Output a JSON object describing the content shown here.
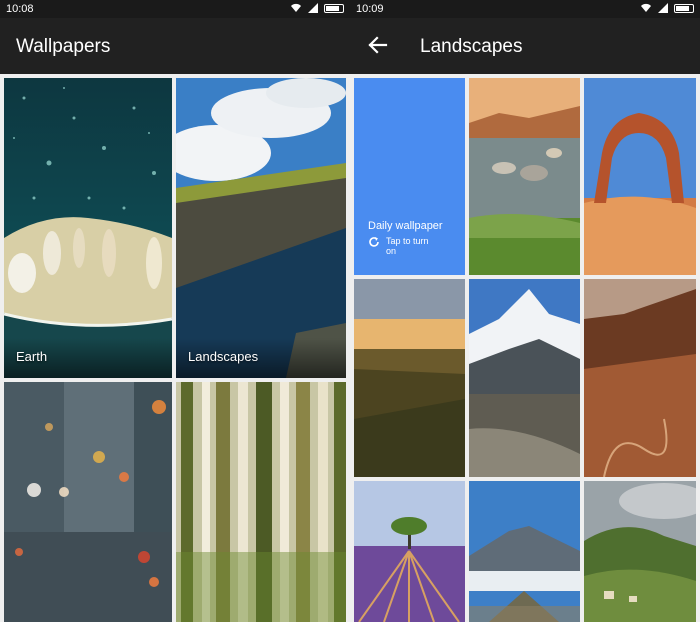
{
  "left_screen": {
    "status": {
      "time": "10:08"
    },
    "app_title": "Wallpapers",
    "categories": [
      {
        "label": "Earth"
      },
      {
        "label": "Landscapes"
      },
      {
        "label": ""
      },
      {
        "label": ""
      }
    ]
  },
  "right_screen": {
    "status": {
      "time": "10:09"
    },
    "app_title": "Landscapes",
    "daily_card": {
      "title": "Daily wallpaper",
      "subtitle_line1": "Tap to turn",
      "subtitle_line2": "on"
    }
  },
  "colors": {
    "app_bar": "#212121",
    "status_bar": "#1a1a1a",
    "daily_card": "#4a8cf0",
    "background": "#efefef"
  },
  "icons": [
    "wifi-icon",
    "signal-icon",
    "battery-icon",
    "back-arrow-icon",
    "refresh-icon"
  ]
}
